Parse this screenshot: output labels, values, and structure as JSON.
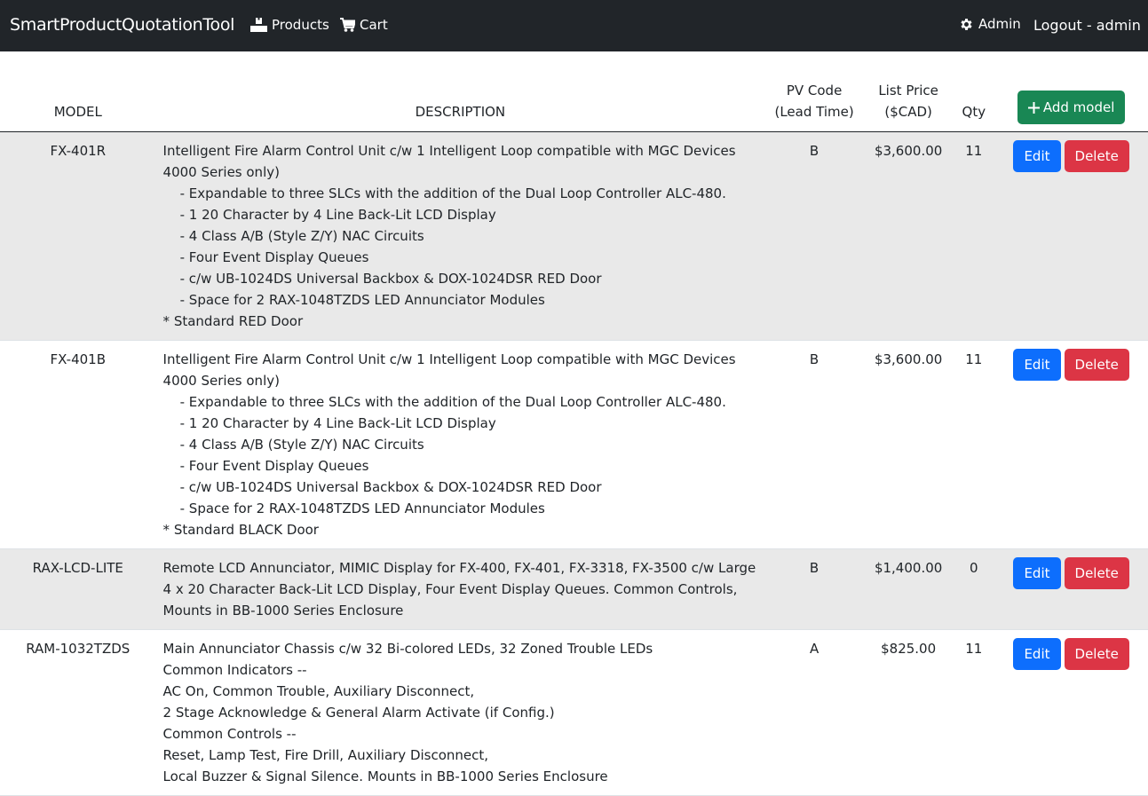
{
  "navbar": {
    "brand": "SmartProductQuotationTool",
    "products_label": "Products",
    "cart_label": "Cart",
    "admin_label": "Admin",
    "logout_label": "Logout - admin"
  },
  "table": {
    "headers": {
      "model": "MODEL",
      "description": "DESCRIPTION",
      "pv_code_line1": "PV Code",
      "pv_code_line2": "(Lead Time)",
      "price_line1": "List Price",
      "price_line2": "($CAD)",
      "qty": "Qty",
      "add_button": "Add model"
    },
    "edit_label": "Edit",
    "delete_label": "Delete",
    "rows": [
      {
        "model": "FX-401R",
        "description": [
          "Intelligent Fire Alarm Control Unit c/w 1 Intelligent Loop compatible with MGC Devices",
          "4000 Series only)",
          "    - Expandable to three SLCs with the addition of the Dual Loop Controller ALC-480.",
          "    - 1 20 Character by 4 Line Back-Lit LCD Display",
          "    - 4 Class A/B (Style Z/Y) NAC Circuits",
          "    - Four Event Display Queues",
          "    - c/w UB-1024DS Universal Backbox & DOX-1024DSR RED Door",
          "    - Space for 2 RAX-1048TZDS LED Annunciator Modules",
          "* Standard RED Door"
        ],
        "pv_code": "B",
        "price": "$3,600.00",
        "qty": "11"
      },
      {
        "model": "FX-401B",
        "description": [
          "Intelligent Fire Alarm Control Unit c/w 1 Intelligent Loop compatible with MGC Devices",
          "4000 Series only)",
          "    - Expandable to three SLCs with the addition of the Dual Loop Controller ALC-480.",
          "    - 1 20 Character by 4 Line Back-Lit LCD Display",
          "    - 4 Class A/B (Style Z/Y) NAC Circuits",
          "    - Four Event Display Queues",
          "    - c/w UB-1024DS Universal Backbox & DOX-1024DSR RED Door",
          "    - Space for 2 RAX-1048TZDS LED Annunciator Modules",
          "* Standard BLACK Door"
        ],
        "pv_code": "B",
        "price": "$3,600.00",
        "qty": "11"
      },
      {
        "model": "RAX-LCD-LITE",
        "description": [
          "Remote LCD Annunciator, MIMIC Display for FX-400, FX-401, FX-3318, FX-3500 c/w Large",
          "4 x 20 Character Back-Lit LCD Display, Four Event Display Queues. Common Controls,",
          "Mounts in BB-1000 Series Enclosure"
        ],
        "pv_code": "B",
        "price": "$1,400.00",
        "qty": "0"
      },
      {
        "model": "RAM-1032TZDS",
        "description": [
          "Main Annunciator Chassis c/w 32 Bi-colored LEDs, 32 Zoned Trouble LEDs",
          "Common Indicators --",
          "AC On, Common Trouble, Auxiliary Disconnect,",
          "2 Stage Acknowledge & General Alarm Activate (if Config.)",
          "Common Controls --",
          "Reset, Lamp Test, Fire Drill, Auxiliary Disconnect,",
          "Local Buzzer & Signal Silence. Mounts in BB-1000 Series Enclosure"
        ],
        "pv_code": "A",
        "price": "$825.00",
        "qty": "11"
      }
    ]
  },
  "icons": {
    "products": "boxes-icon",
    "cart": "cart-icon",
    "admin": "gear-icon",
    "add": "plus-icon"
  },
  "colors": {
    "navbar": "#212529",
    "edit": "#0d6efd",
    "delete": "#dc3545",
    "add": "#198754",
    "row_shade": "#e9e9e9"
  }
}
